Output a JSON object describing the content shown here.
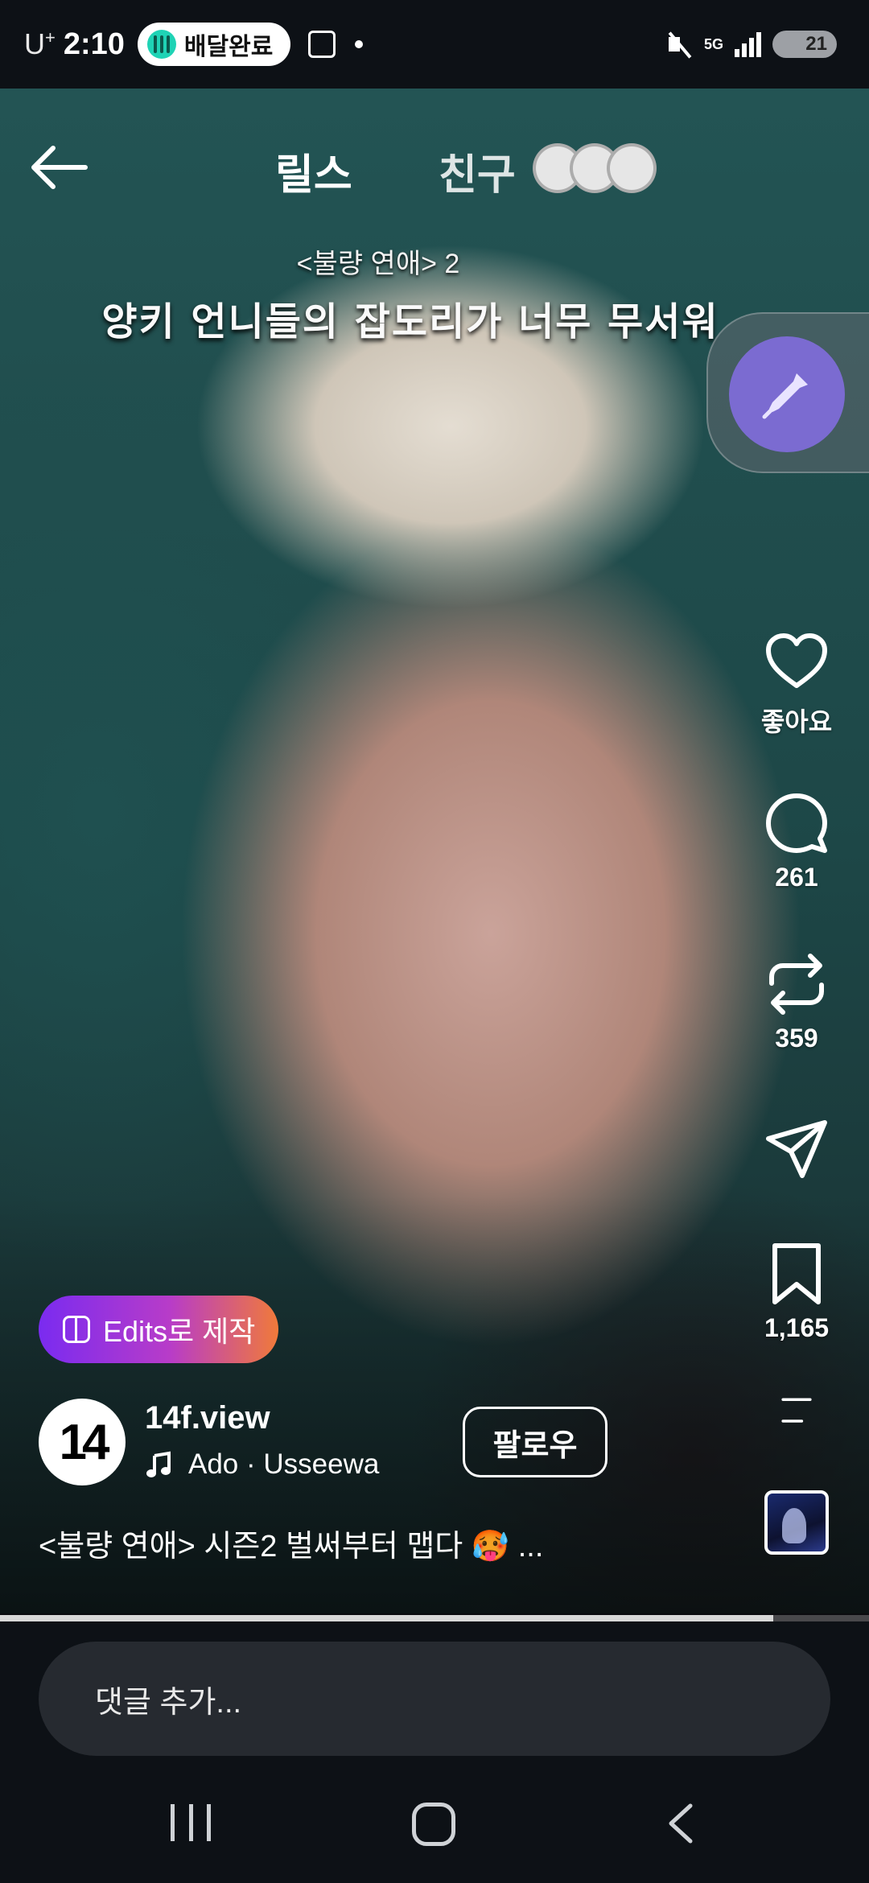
{
  "status_bar": {
    "carrier": "U",
    "carrier_sup": "+",
    "time": "2:10",
    "notification_pill": "배달완료",
    "network": "5G",
    "battery": "21"
  },
  "top_nav": {
    "tab_reels": "릴스",
    "tab_friends": "친구"
  },
  "video": {
    "caption_line1": "<불량 연애> 2",
    "caption_line2": "양키 언니들의 잡도리가 너무 무서워"
  },
  "actions": {
    "like_label": "좋아요",
    "comments_count": "261",
    "reposts_count": "359",
    "saves_count": "1,165"
  },
  "edits_button": "Edits로 제작",
  "author": {
    "avatar_text": "14",
    "username": "14f.view",
    "music": "Ado · Usseewa",
    "follow_label": "팔로우"
  },
  "post_caption": "<불량 연애> 시즌2 벌써부터 맵다 🥵 ...",
  "progress_fraction": 0.89,
  "comment_placeholder": "댓글 추가...",
  "colors": {
    "edits_gradient_start": "#7a2bf0",
    "edits_gradient_end": "#f07a3a",
    "pin_button": "#7b6bd1",
    "pill_icon": "#1fd3b5"
  }
}
